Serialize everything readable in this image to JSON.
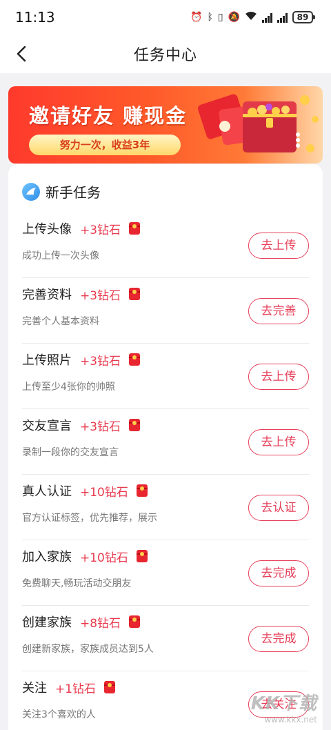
{
  "status_bar": {
    "time": "11:13",
    "battery": "89",
    "icons": [
      "alarm-icon",
      "bluetooth-icon",
      "vibrate-icon",
      "mute-icon",
      "wifi-icon",
      "signal-4g-icon",
      "signal-4g-icon",
      "battery-icon"
    ]
  },
  "header": {
    "title": "任务中心"
  },
  "banner": {
    "title": "邀请好友 赚现金",
    "subtitle": "努力一次，收益3年"
  },
  "section": {
    "title": "新手任务"
  },
  "tasks": [
    {
      "name": "上传头像",
      "reward": "+3钻石",
      "desc": "成功上传一次头像",
      "button": "去上传"
    },
    {
      "name": "完善资料",
      "reward": "+3钻石",
      "desc": "完善个人基本资料",
      "button": "去完善"
    },
    {
      "name": "上传照片",
      "reward": "+3钻石",
      "desc": "上传至少4张你的帅照",
      "button": "去上传"
    },
    {
      "name": "交友宣言",
      "reward": "+3钻石",
      "desc": "录制一段你的交友宣言",
      "button": "去上传"
    },
    {
      "name": "真人认证",
      "reward": "+10钻石",
      "desc": "官方认证标签，优先推荐，展示",
      "button": "去认证"
    },
    {
      "name": "加入家族",
      "reward": "+10钻石",
      "desc": "免费聊天,畅玩活动交朋友",
      "button": "去完成"
    },
    {
      "name": "创建家族",
      "reward": "+8钻石",
      "desc": "创建新家族，家族成员达到5人",
      "button": "去完成"
    },
    {
      "name": "关注",
      "reward": "+1钻石",
      "desc": "关注3个喜欢的人",
      "button": "去关注"
    }
  ],
  "watermark": {
    "logo": "KK下载",
    "url": "www.kkx.net"
  },
  "colors": {
    "accent": "#e6405a",
    "reward": "#e83a4e",
    "banner_start": "#ff3a2c",
    "banner_end": "#ffd7a8"
  }
}
